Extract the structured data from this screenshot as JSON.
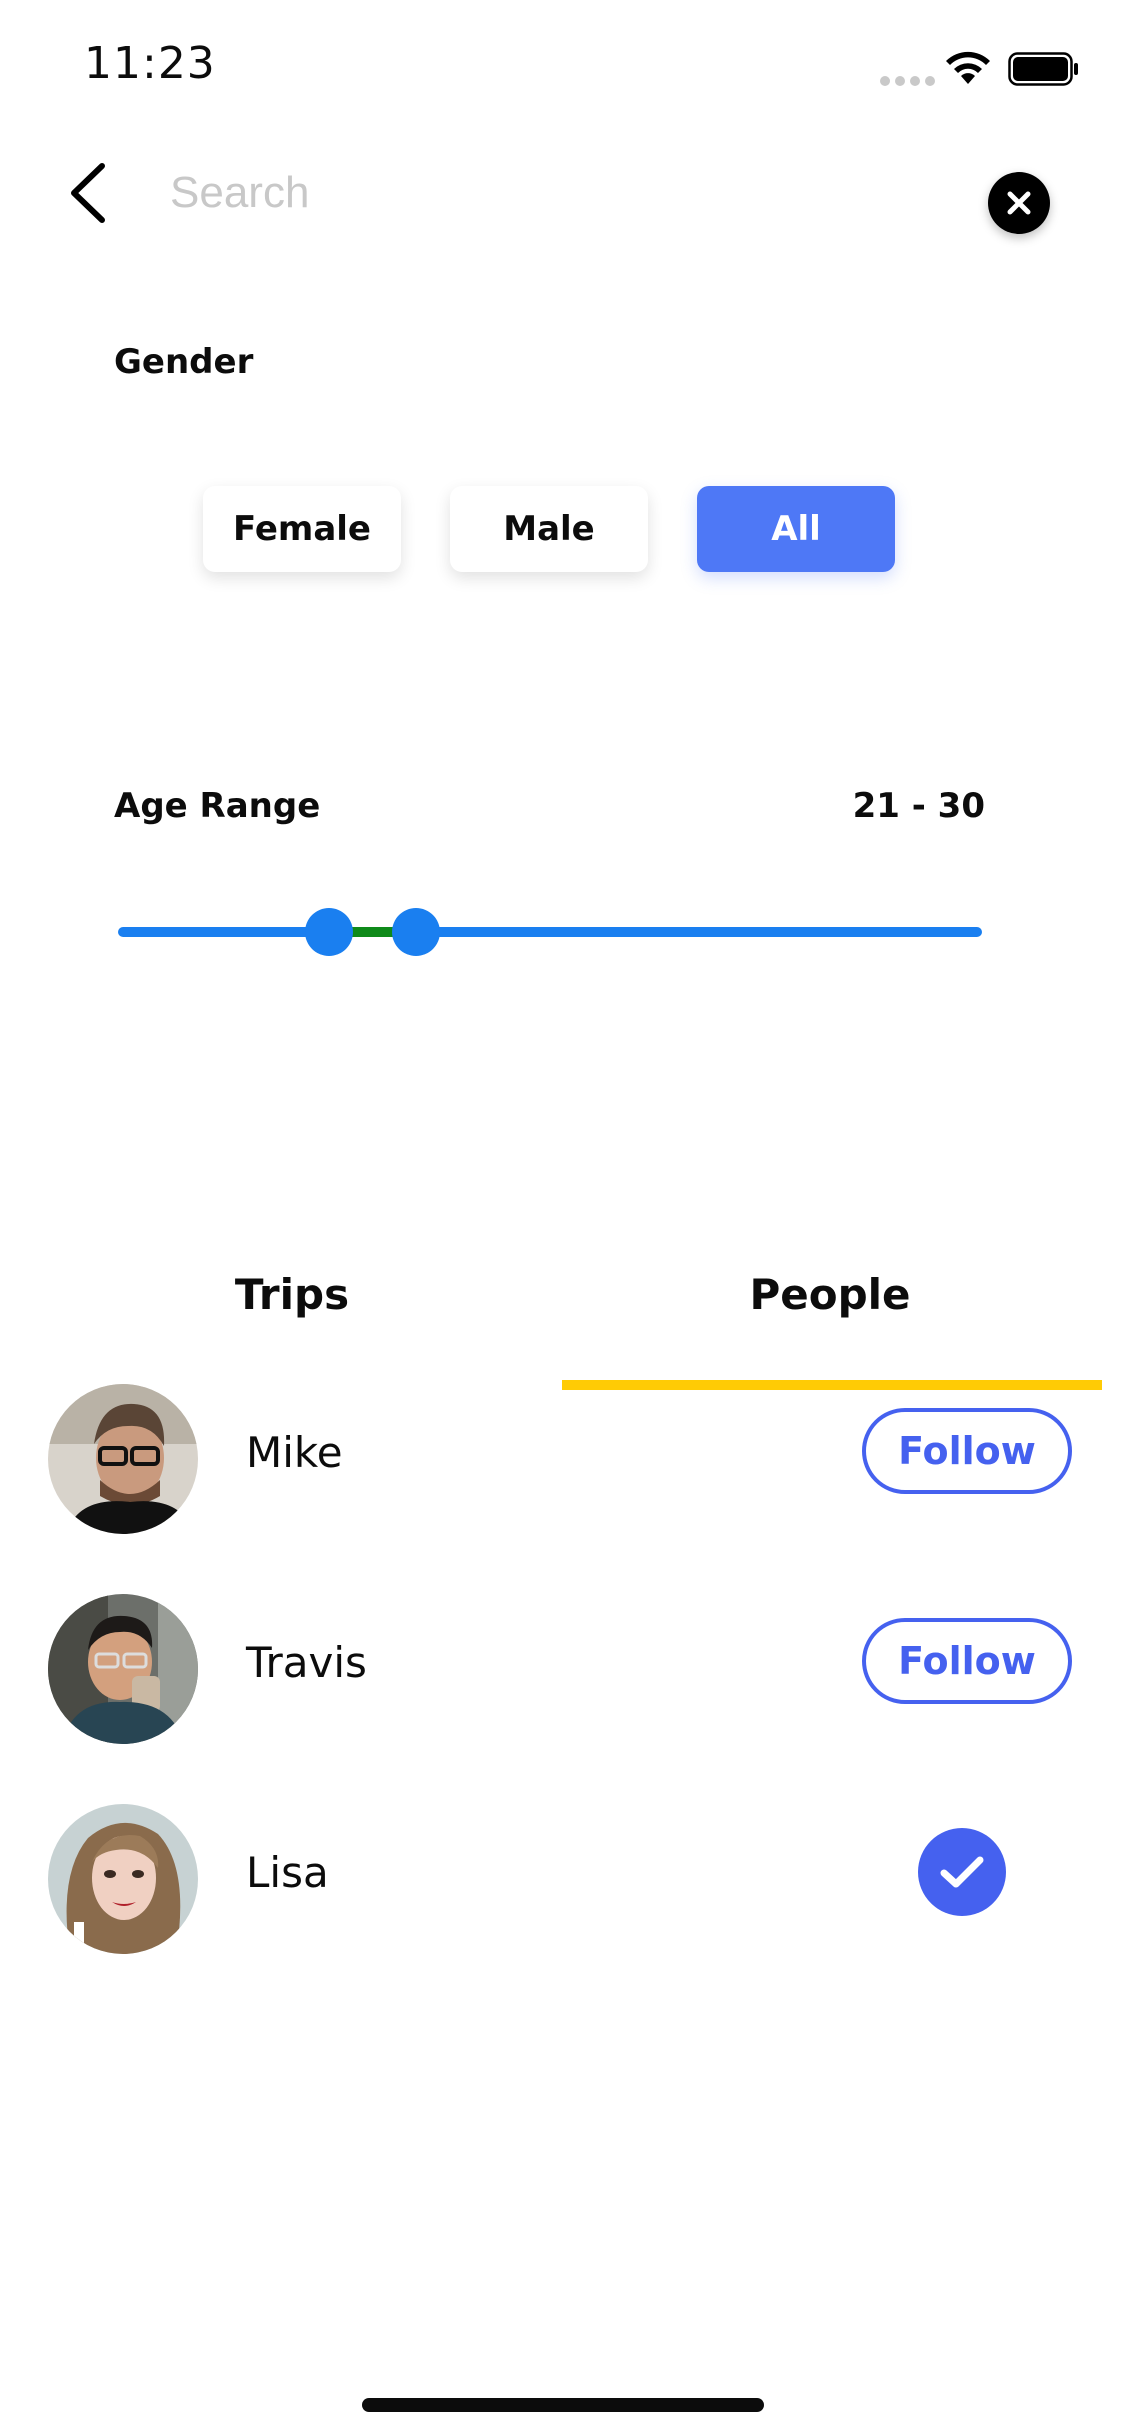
{
  "status_bar": {
    "time": "11:23"
  },
  "search": {
    "placeholder": "Search",
    "value": ""
  },
  "filters": {
    "gender": {
      "label": "Gender",
      "options": [
        "Female",
        "Male",
        "All"
      ],
      "selected": "All"
    },
    "age_range": {
      "label": "Age Range",
      "value_text": "21 - 30",
      "min": 21,
      "max": 30
    }
  },
  "tabs": {
    "items": [
      "Trips",
      "People"
    ],
    "active": "People"
  },
  "people": [
    {
      "name": "Mike",
      "action": "Follow",
      "following": false
    },
    {
      "name": "Travis",
      "action": "Follow",
      "following": false
    },
    {
      "name": "Lisa",
      "action": "",
      "following": true
    }
  ],
  "colors": {
    "accent": "#4e78f6",
    "follow": "#4561ef",
    "slider": "#1a7ff0",
    "slider_selected": "#0f8a1a",
    "tab_indicator": "#ffcb05"
  }
}
